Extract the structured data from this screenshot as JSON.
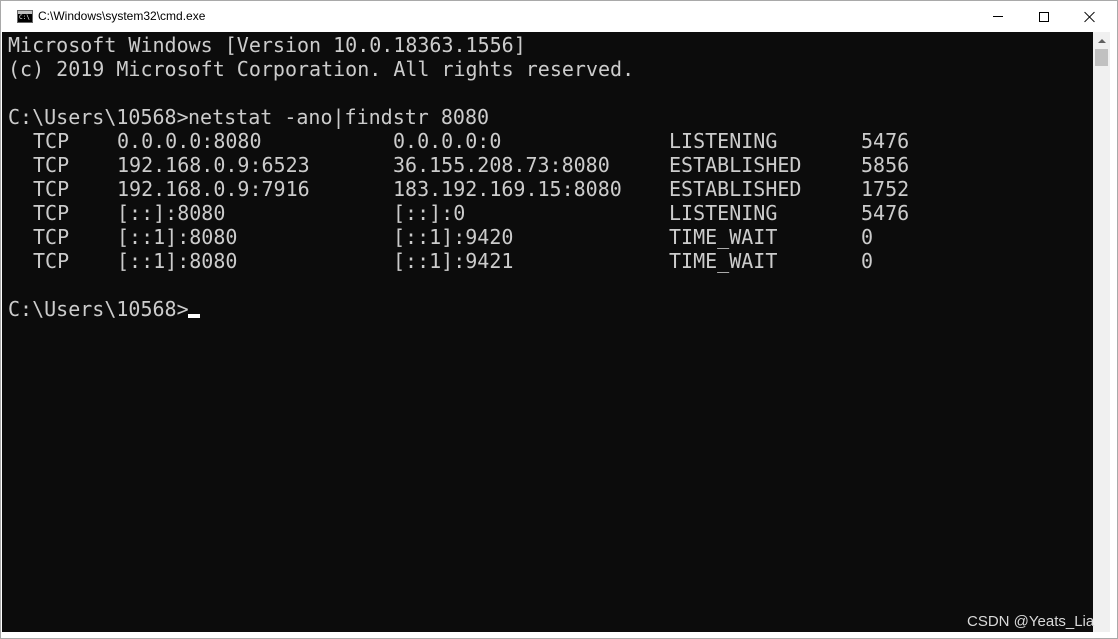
{
  "window": {
    "title": "C:\\Windows\\system32\\cmd.exe",
    "icon": "cmd-icon"
  },
  "controls": {
    "minimize_icon": "minimize-icon",
    "maximize_icon": "maximize-icon",
    "close_icon": "close-icon"
  },
  "console": {
    "banner_line1": "Microsoft Windows [Version 10.0.18363.1556]",
    "banner_line2": "(c) 2019 Microsoft Corporation. All rights reserved.",
    "command_prompt": "C:\\Users\\10568>",
    "command": "netstat -ano|findstr 8080",
    "netstat_rows": [
      {
        "proto": "TCP",
        "local": "0.0.0.0:8080",
        "foreign": "0.0.0.0:0",
        "state": "LISTENING",
        "pid": "5476"
      },
      {
        "proto": "TCP",
        "local": "192.168.0.9:6523",
        "foreign": "36.155.208.73:8080",
        "state": "ESTABLISHED",
        "pid": "5856"
      },
      {
        "proto": "TCP",
        "local": "192.168.0.9:7916",
        "foreign": "183.192.169.15:8080",
        "state": "ESTABLISHED",
        "pid": "1752"
      },
      {
        "proto": "TCP",
        "local": "[::]:8080",
        "foreign": "[::]:0",
        "state": "LISTENING",
        "pid": "5476"
      },
      {
        "proto": "TCP",
        "local": "[::1]:8080",
        "foreign": "[::1]:9420",
        "state": "TIME_WAIT",
        "pid": "0"
      },
      {
        "proto": "TCP",
        "local": "[::1]:8080",
        "foreign": "[::1]:9421",
        "state": "TIME_WAIT",
        "pid": "0"
      }
    ],
    "final_prompt": "C:\\Users\\10568>",
    "text_color": "#cccccc",
    "background_color": "#0c0c0c"
  },
  "watermark": "CSDN @Yeats_Lia"
}
